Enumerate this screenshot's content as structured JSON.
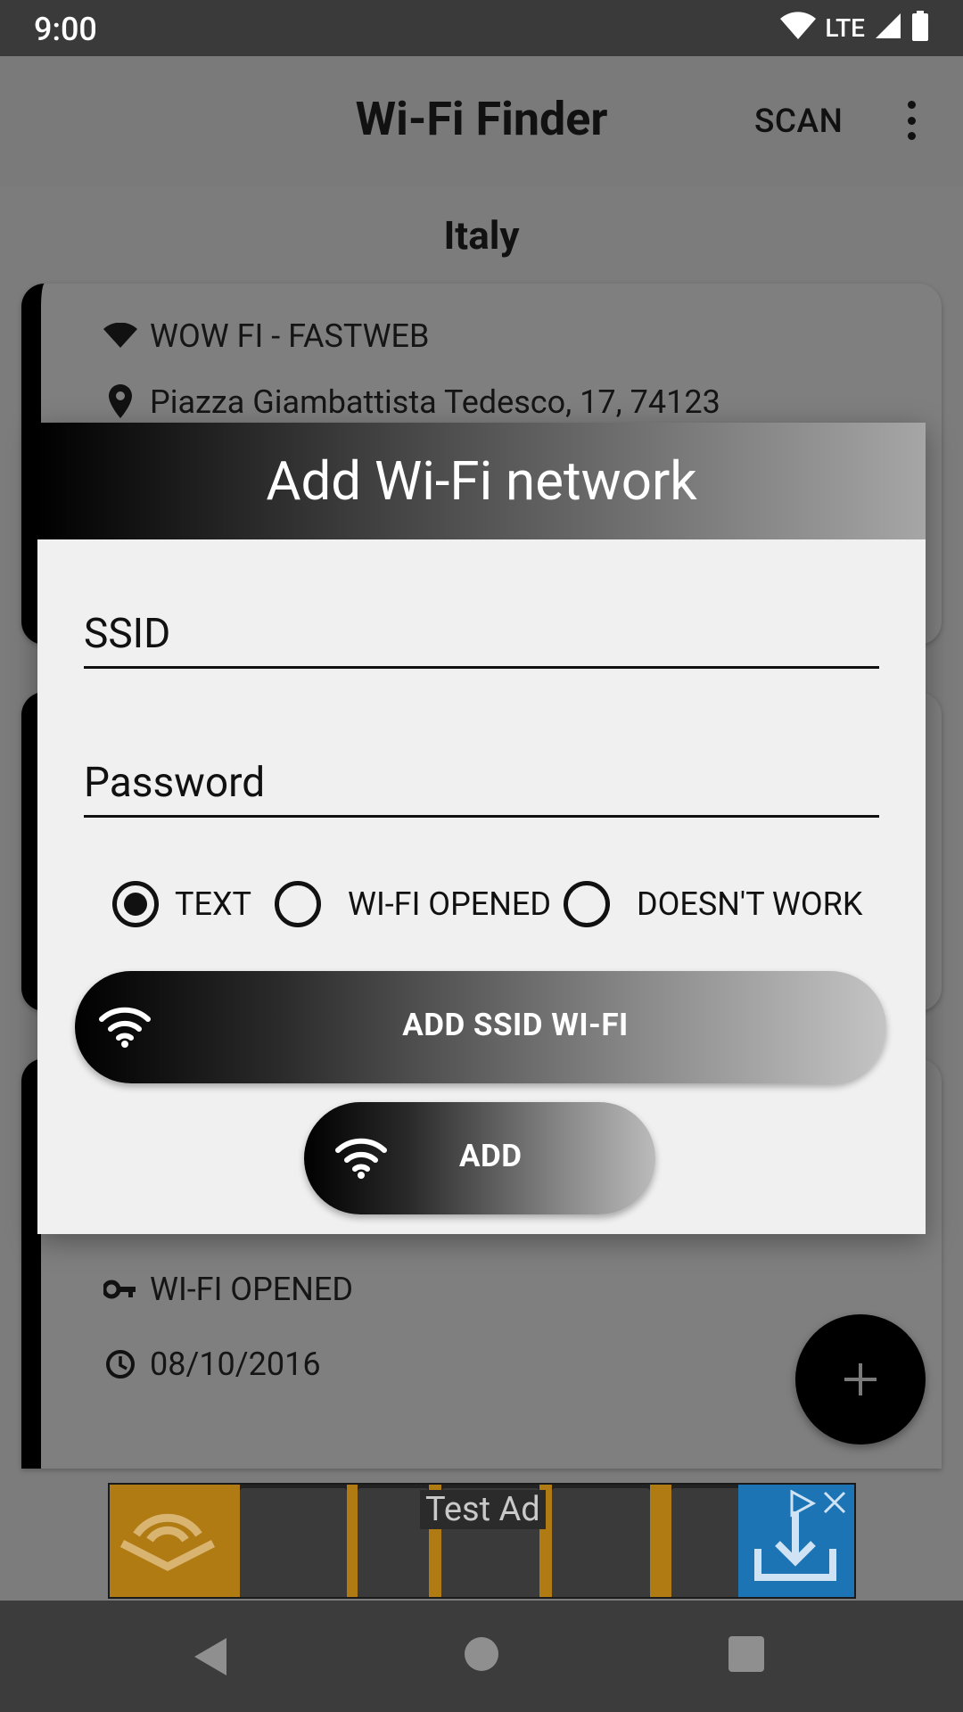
{
  "status_bar": {
    "time": "9:00",
    "network": "LTE"
  },
  "app_bar": {
    "title": "Wi-Fi Finder",
    "scan_label": "SCAN"
  },
  "section_title": "Italy",
  "cards": [
    {
      "network_name": "WOW FI - FASTWEB",
      "address": "Piazza Giambattista Tedesco, 17, 74123"
    },
    {
      "security": "WI-FI OPENED",
      "date": "08/10/2016"
    }
  ],
  "dialog": {
    "title": "Add Wi-Fi network",
    "ssid_placeholder": "SSID",
    "password_placeholder": "Password",
    "radio_options": [
      "TEXT",
      "WI-FI OPENED",
      "DOESN'T WORK"
    ],
    "selected_option": "TEXT",
    "add_ssid_button": "ADD SSID WI-FI",
    "add_button": "ADD"
  },
  "ad": {
    "label": "Test Ad"
  },
  "colors": {
    "accent": "#000000",
    "scrim": "#7c7c7c",
    "dialog_bg": "#f0f0f0"
  }
}
